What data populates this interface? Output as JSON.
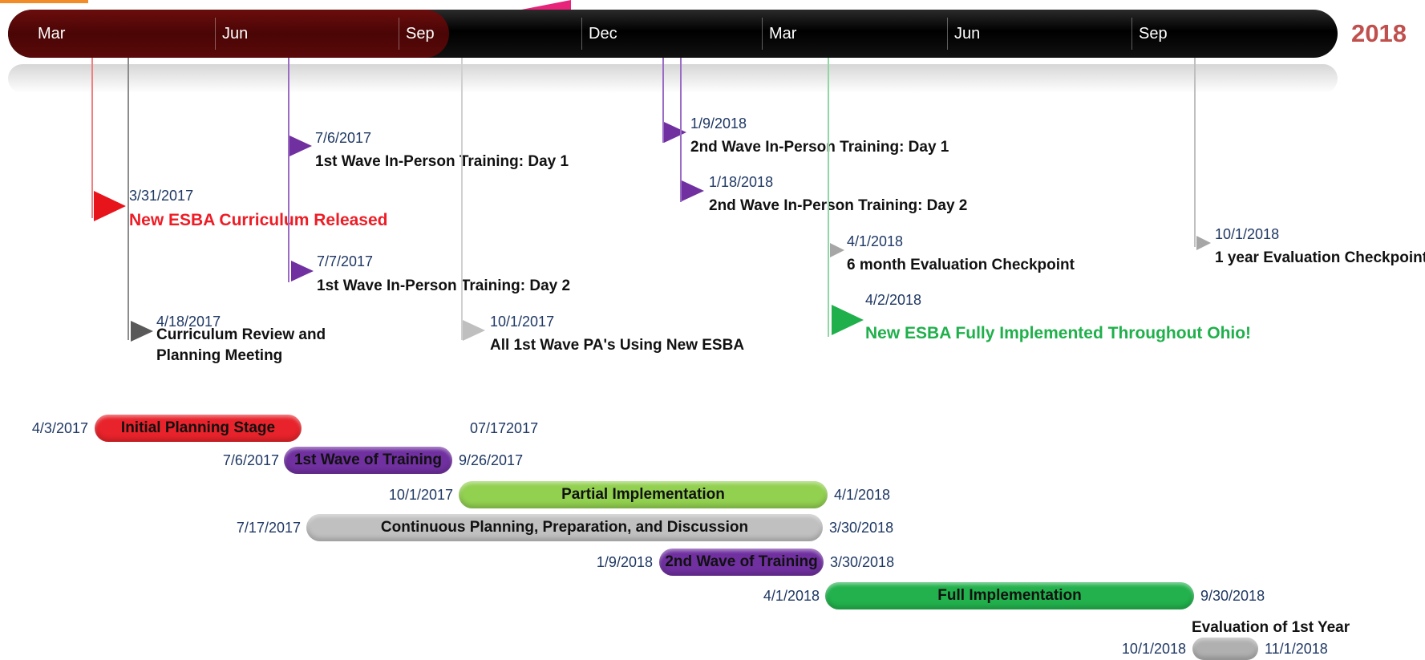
{
  "timeline": {
    "year_label": "2018",
    "months": [
      "Mar",
      "Jun",
      "Sep",
      "Dec",
      "Mar",
      "Jun",
      "Sep"
    ],
    "colors": {
      "past_band": "#4a0505",
      "bar": "#000000",
      "year": "#c0504d"
    }
  },
  "milestones": [
    {
      "date": "3/31/2017",
      "label": "New ESBA Curriculum Released",
      "color": "#ee1c25"
    },
    {
      "date": "4/18/2017",
      "label": "Curriculum Review and Planning Meeting",
      "color": "#595959"
    },
    {
      "date": "7/6/2017",
      "label": "1st Wave In-Person Training: Day 1",
      "color": "#7030a0"
    },
    {
      "date": "7/7/2017",
      "label": "1st Wave  In-Person Training: Day 2",
      "color": "#7030a0"
    },
    {
      "date": "10/1/2017",
      "label": "All 1st Wave PA's Using New ESBA",
      "color": "#bfbfbf"
    },
    {
      "date": "1/9/2018",
      "label": "2nd Wave In-Person Training: Day 1",
      "color": "#7030a0"
    },
    {
      "date": "1/18/2018",
      "label": "2nd Wave In-Person Training: Day 2",
      "color": "#7030a0"
    },
    {
      "date": "4/1/2018",
      "label": "6 month Evaluation Checkpoint",
      "color": "#a6a6a6"
    },
    {
      "date": "4/2/2018",
      "label": "New ESBA Fully Implemented Throughout Ohio!",
      "color": "#1fb04b"
    },
    {
      "date": "10/1/2018",
      "label": "1 year Evaluation Checkpoint",
      "color": "#a6a6a6"
    }
  ],
  "tasks": [
    {
      "label": "Initial Planning Stage",
      "start": "4/3/2017",
      "end": "07/172017",
      "color": "#e8232b"
    },
    {
      "label": "1st Wave of Training",
      "start": "7/6/2017",
      "end": "9/26/2017",
      "color": "#7030a0"
    },
    {
      "label": "Partial Implementation",
      "start": "10/1/2017",
      "end": "4/1/2018",
      "color": "#92d050"
    },
    {
      "label": "Continuous Planning, Preparation, and Discussion",
      "start": "7/17/2017",
      "end": "3/30/2018",
      "color": "#c0c0c0"
    },
    {
      "label": "2nd Wave of Training",
      "start": "1/9/2018",
      "end": "3/30/2018",
      "color": "#7030a0"
    },
    {
      "label": "Full Implementation",
      "start": "4/1/2018",
      "end": "9/30/2018",
      "color": "#22b14c"
    },
    {
      "label": "Evaluation of 1st Year",
      "start": "10/1/2018",
      "end": "11/1/2018",
      "color": "#b0b0b0"
    }
  ]
}
